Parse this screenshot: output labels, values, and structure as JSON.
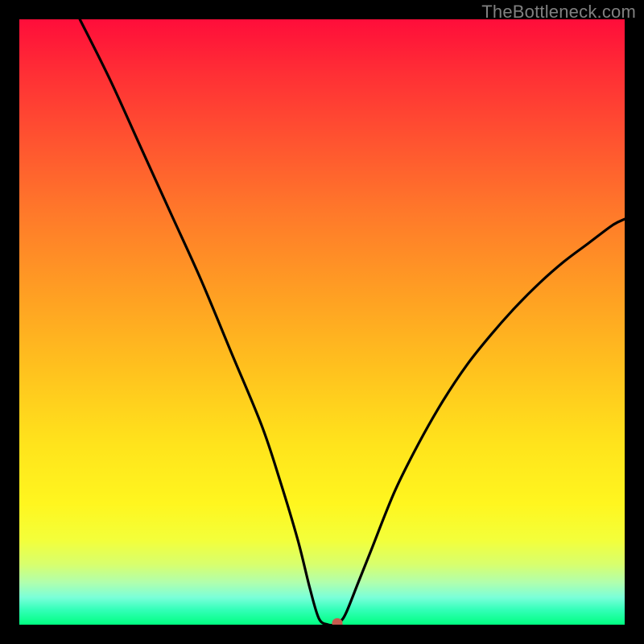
{
  "watermark": "TheBottleneck.com",
  "chart_data": {
    "type": "line",
    "title": "",
    "xlabel": "",
    "ylabel": "",
    "xlim": [
      0,
      100
    ],
    "ylim": [
      0,
      100
    ],
    "series": [
      {
        "name": "curve",
        "x": [
          10,
          15,
          20,
          25,
          30,
          35,
          40,
          43,
          46,
          48,
          49.5,
          51,
          52,
          53,
          54,
          56,
          58,
          62,
          66,
          70,
          74,
          78,
          82,
          86,
          90,
          94,
          98,
          100
        ],
        "y": [
          100,
          90,
          79,
          68,
          57,
          45,
          33,
          24,
          14,
          6,
          1,
          0,
          0,
          0.5,
          2,
          7,
          12,
          22,
          30,
          37,
          43,
          48,
          52.5,
          56.5,
          60,
          63,
          66,
          67
        ]
      }
    ],
    "marker": {
      "x": 52.5,
      "y": 0,
      "color": "#c65a4f"
    },
    "background_gradient": {
      "top": "#ff0d3a",
      "mid": "#ffe31c",
      "bottom": "#00ff80"
    }
  }
}
